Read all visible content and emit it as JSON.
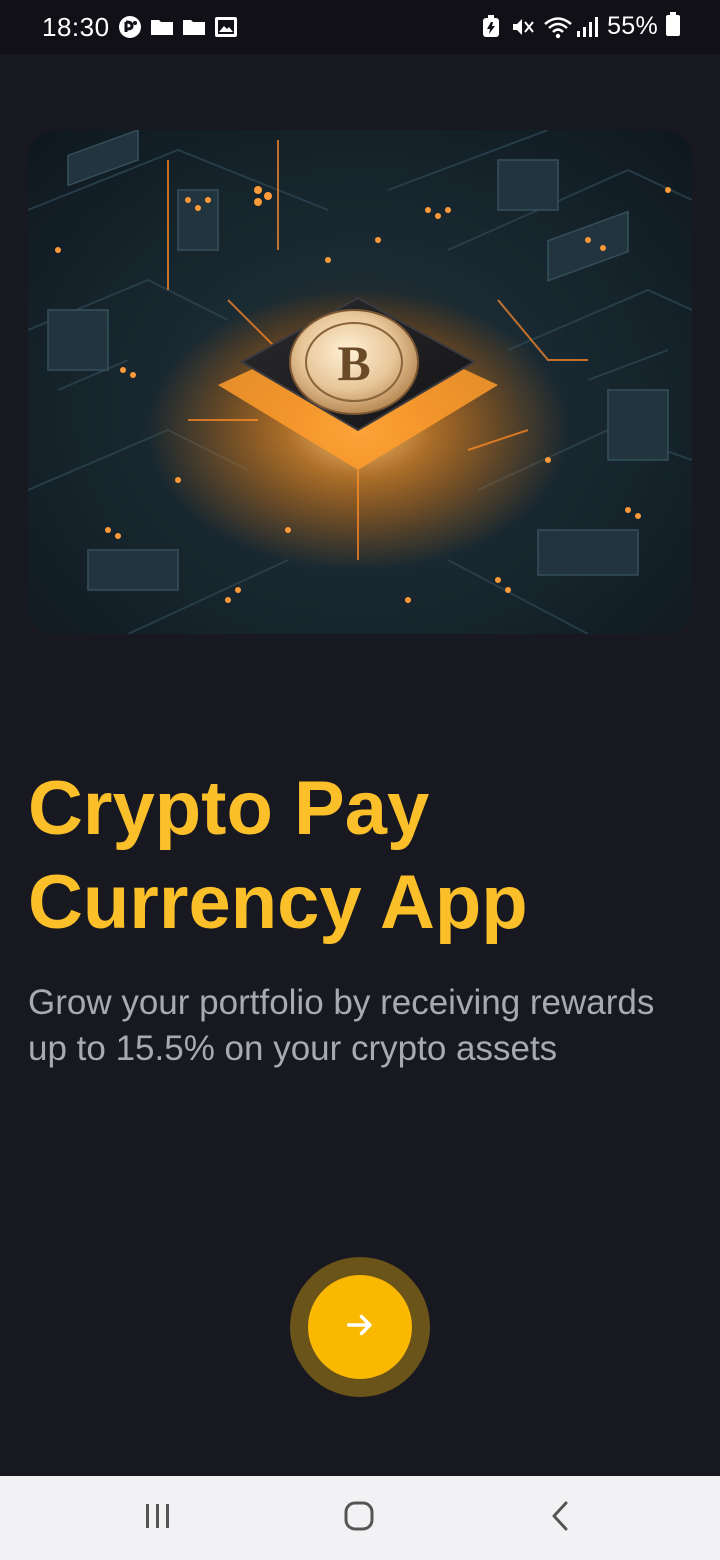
{
  "status_bar": {
    "time": "18:30",
    "battery": "55%",
    "left_icons": [
      "messenger-icon",
      "folder-icon",
      "folder-icon",
      "image-icon"
    ],
    "right_icons": [
      "battery-saver-icon",
      "mute-icon",
      "wifi-icon",
      "signal-icon",
      "battery-icon"
    ]
  },
  "onboarding": {
    "title_line1": "Crypto Pay",
    "title_line2": "Currency App",
    "description": "Grow your portfolio by receiving rewards up to 15.5% on your crypto assets",
    "next_icon": "arrow-right-icon"
  },
  "nav_bar": {
    "buttons": [
      "recent-apps-icon",
      "home-icon",
      "back-icon"
    ]
  },
  "colors": {
    "background": "#181820",
    "accent": "#fbbf2a",
    "button": "#fbb800",
    "button_ring": "#6a541a",
    "subtitle": "#a8a9b1"
  }
}
